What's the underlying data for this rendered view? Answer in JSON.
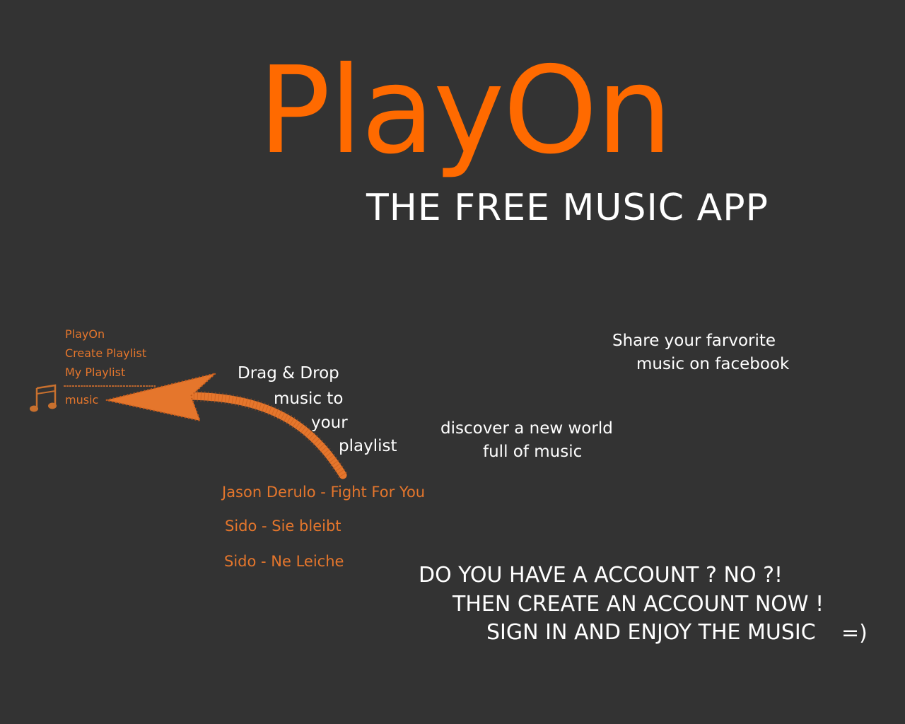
{
  "brand": {
    "logo": "PlayOn",
    "tagline": "THE FREE MUSIC APP",
    "accent": "#ff6a00"
  },
  "sidebar": {
    "items": [
      {
        "label": "PlayOn"
      },
      {
        "label": "Create Playlist"
      },
      {
        "label": "My Playlist"
      },
      {
        "label": "music"
      }
    ],
    "icon": "music-notes-icon"
  },
  "notes": {
    "drag_drop": [
      "Drag & Drop",
      "music to",
      "your",
      "playlist"
    ],
    "discover": [
      "discover a new world",
      "full of music"
    ],
    "share": [
      "Share your farvorite",
      "music on facebook"
    ]
  },
  "songs": [
    {
      "title": "Jason Derulo - Fight For You"
    },
    {
      "title": "Sido - Sie bleibt"
    },
    {
      "title": "Sido -  Ne Leiche"
    }
  ],
  "cta": {
    "line1": "DO YOU HAVE A ACCOUNT ? NO ?!",
    "line2": "THEN CREATE AN ACCOUNT NOW !",
    "line3": "SIGN IN  AND  ENJOY THE MUSIC",
    "smiley": "=)"
  },
  "colors": {
    "background": "#333333",
    "accent": "#ff6a00",
    "menu": "#e5762c",
    "text": "#ffffff"
  }
}
